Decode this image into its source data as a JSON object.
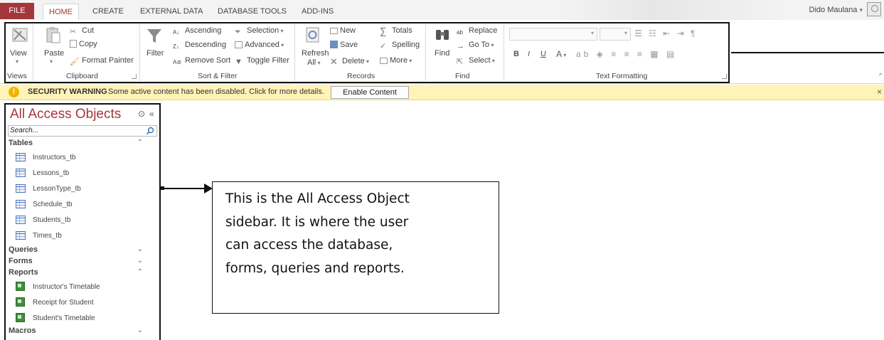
{
  "tabs": [
    {
      "label": "FILE"
    },
    {
      "label": "HOME",
      "active": true
    },
    {
      "label": "CREATE"
    },
    {
      "label": "EXTERNAL DATA"
    },
    {
      "label": "DATABASE TOOLS"
    },
    {
      "label": "ADD-INS"
    }
  ],
  "user": {
    "name": "Dido Maulana",
    "dropdown": "▾"
  },
  "ribbon": {
    "views": {
      "view": "View",
      "group": "Views"
    },
    "clipboard": {
      "paste": "Paste",
      "cut": "Cut",
      "copy": "Copy",
      "format_painter": "Format Painter",
      "group": "Clipboard"
    },
    "sort_filter": {
      "filter": "Filter",
      "ascending": "Ascending",
      "descending": "Descending",
      "remove_sort": "Remove Sort",
      "selection": "Selection",
      "advanced": "Advanced",
      "toggle_filter": "Toggle Filter",
      "group": "Sort & Filter"
    },
    "records": {
      "refresh": "Refresh",
      "refresh_all": "All",
      "new": "New",
      "save": "Save",
      "delete": "Delete",
      "totals": "Totals",
      "spelling": "Spelling",
      "more": "More",
      "group": "Records"
    },
    "find": {
      "find": "Find",
      "replace": "Replace",
      "go_to": "Go To",
      "select": "Select",
      "group": "Find"
    },
    "text_formatting": {
      "bold": "B",
      "italic": "I",
      "underline": "U",
      "font_color": "A",
      "group": "Text Formatting"
    }
  },
  "security": {
    "title": "SECURITY WARNING",
    "message": "Some active content has been disabled. Click for more details.",
    "button": "Enable Content",
    "close": "×"
  },
  "nav": {
    "title": "All Access Objects",
    "search_placeholder": "Search...",
    "sections": {
      "tables": "Tables",
      "queries": "Queries",
      "forms": "Forms",
      "reports": "Reports",
      "macros": "Macros"
    },
    "tables": [
      "Instructors_tb",
      "Lessons_tb",
      "LessonType_tb",
      "Schedule_tb",
      "Students_tb",
      "Times_tb"
    ],
    "reports": [
      "Instructor's Timetable",
      "Receipt for Student",
      "Student's Timetable"
    ]
  },
  "callout": {
    "lines": [
      "This is the All Access Object",
      "sidebar. It is where the user",
      "can access the database,",
      "forms, queries and reports."
    ]
  },
  "colors": {
    "accent": "#a4373a",
    "warning_bar": "#fff3b8",
    "table_icon": "#4b76b8",
    "report_icon": "#3f8f3a"
  }
}
